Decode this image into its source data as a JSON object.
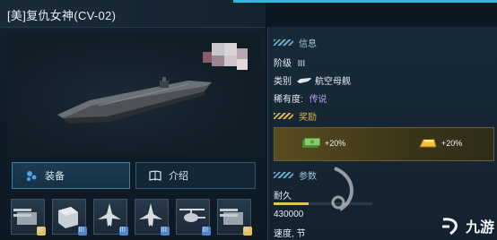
{
  "window": {
    "title": "[美]复仇女神(CV-02)"
  },
  "tabs": [
    {
      "label": "装备",
      "icon": "equipment-icon",
      "active": true
    },
    {
      "label": "介绍",
      "icon": "book-icon",
      "active": false
    }
  ],
  "slots": [
    {
      "icon": "cannon-turret-icon",
      "quality": "gold",
      "level": "III"
    },
    {
      "icon": "armor-box-icon",
      "quality": "blue",
      "level": "III"
    },
    {
      "icon": "jet-fighter-icon",
      "quality": "blue",
      "level": "III"
    },
    {
      "icon": "jet-fighter-icon",
      "quality": "blue",
      "level": "III"
    },
    {
      "icon": "helicopter-icon",
      "quality": "blue",
      "level": "III"
    },
    {
      "icon": "cannon-turret-icon",
      "quality": "gold",
      "level": "III"
    }
  ],
  "info": {
    "section_title": "信息",
    "level_label": "阶级",
    "level_value": "III",
    "type_label": "类别",
    "type_value": "航空母舰",
    "rarity_label": "稀有度:",
    "rarity_value": "传说"
  },
  "reward": {
    "section_title": "奖励",
    "items": [
      {
        "icon": "cash-icon",
        "text": "+20%"
      },
      {
        "icon": "gold-bar-icon",
        "text": "+20%"
      }
    ]
  },
  "params": {
    "section_title": "参数",
    "durability_label": "耐久",
    "durability_value": "430000",
    "durability_fill": 0.35,
    "speed_label": "速度, 节"
  },
  "watermark": {
    "text": "九游"
  },
  "colors": {
    "accent": "#2fb6d8",
    "gold": "#e0b44f",
    "legendary": "#b59bf0",
    "background": "#0b1721"
  }
}
